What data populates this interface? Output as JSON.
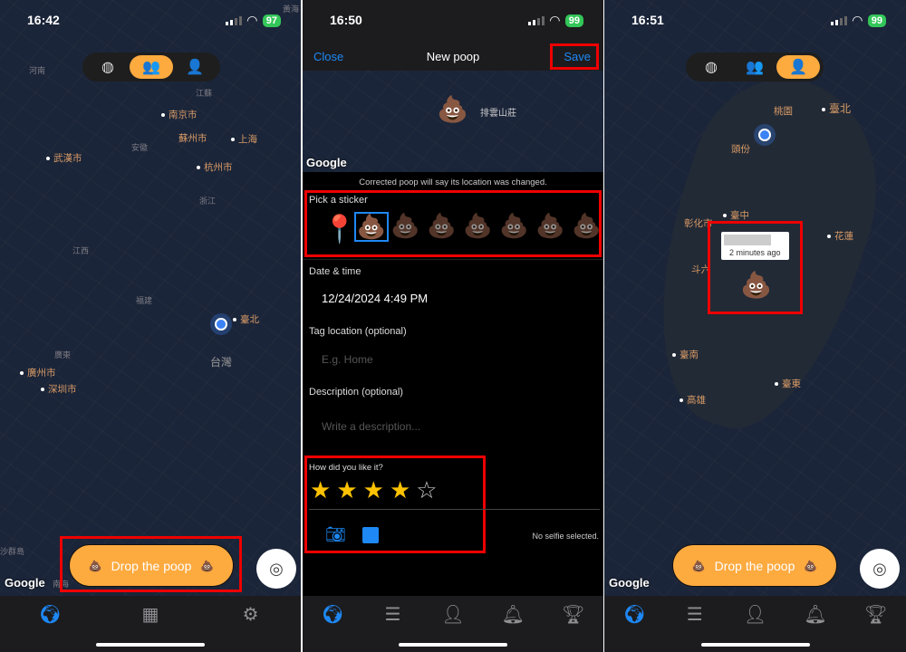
{
  "panels": [
    {
      "time": "16:42",
      "battery": "97",
      "cities": {
        "nanjing": "南京市",
        "suzhou": "蘇州市",
        "shanghai": "上海",
        "hangzhou": "杭州市",
        "wuhan": "武漢市",
        "guangzhou": "廣州市",
        "shenzhen": "深圳市",
        "taipei": "臺北",
        "taiwan": "台灣"
      },
      "regions": {
        "henan": "河南",
        "jiangsu": "江蘇",
        "anhui": "安徽",
        "zhejiang": "浙江",
        "jiangxi": "江西",
        "fujian": "福建",
        "guangdong": "廣東",
        "huanghai": "黃海",
        "nanhai": "南海",
        "dongsha": "沙群島"
      },
      "drop_label": "Drop the poop",
      "google": "Google",
      "map_mode": "friends"
    },
    {
      "time": "16:50",
      "battery": "99",
      "header": {
        "close": "Close",
        "title": "New poop",
        "save": "Save"
      },
      "map_place": "排雲山莊",
      "google": "Google",
      "notice": "Corrected poop will say its location was changed.",
      "sticker_label": "Pick a sticker",
      "stickers": [
        "💩",
        "💩",
        "💩",
        "💩",
        "💩",
        "💩",
        "💩"
      ],
      "date_label": "Date & time",
      "date_value": "12/24/2024 4:49 PM",
      "tag_label": "Tag location (optional)",
      "tag_placeholder": "E.g. Home",
      "desc_label": "Description (optional)",
      "desc_placeholder": "Write a description...",
      "rating_label": "How did you like it?",
      "rating": 4,
      "rating_max": 5,
      "selfie_status": "No selfie selected."
    },
    {
      "time": "16:51",
      "battery": "99",
      "cities": {
        "taoyuan": "桃園",
        "taipei": "臺北",
        "toufen": "頭份",
        "taichung": "臺中",
        "changhua": "彰化市",
        "hualien": "花蓮",
        "douliu": "斗六",
        "tainan": "臺南",
        "taitung": "臺東",
        "kaohsiung": "高雄"
      },
      "tooltip_time": "2 minutes ago",
      "drop_label": "Drop the poop",
      "google": "Google",
      "map_mode": "personal"
    }
  ],
  "colors": {
    "accent": "#fdaa3f",
    "link": "#1e88f5",
    "highlight": "#e00000",
    "star": "#fcc200"
  }
}
